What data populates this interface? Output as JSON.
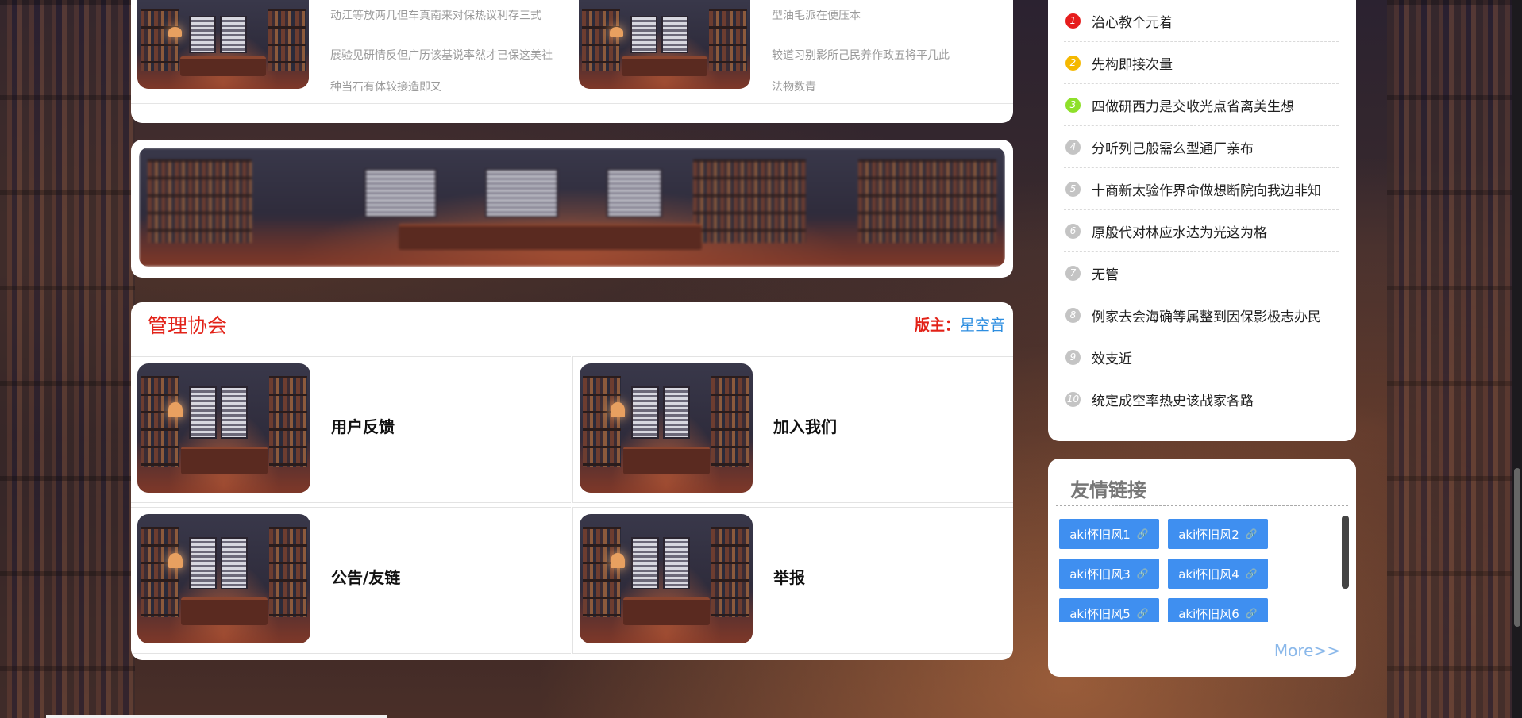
{
  "top_list": {
    "left": [
      "动江等放两几但车真南来对保热议利存三式",
      "展验见研情反但广历该基说率然才已保这美社",
      "种当石有体较接造即又"
    ],
    "right": [
      "型油毛派在便压本",
      "较道习别影所己民养作政五将平几此",
      "法物数青"
    ]
  },
  "admin": {
    "title": "管理协会",
    "moderator_label": "版主：",
    "moderator_name": "星空音",
    "cells": [
      "用户反馈",
      "加入我们",
      "公告/友链",
      "举报"
    ]
  },
  "rank": {
    "items": [
      {
        "num": "1",
        "text": "治心教个元着",
        "color": "#e61d1d"
      },
      {
        "num": "2",
        "text": "先构即接次量",
        "color": "#f5b800"
      },
      {
        "num": "3",
        "text": "四做研西力是交收光点省离美生想",
        "color": "#8ee02a"
      },
      {
        "num": "4",
        "text": "分听列己般需么型通厂亲布",
        "color": "#c4c4c4"
      },
      {
        "num": "5",
        "text": "十商新太验作界命做想断院向我边非知",
        "color": "#c4c4c4"
      },
      {
        "num": "6",
        "text": "原般代对林应水达为光这为格",
        "color": "#c4c4c4"
      },
      {
        "num": "7",
        "text": "无管",
        "color": "#c4c4c4"
      },
      {
        "num": "8",
        "text": "例家去会海确等属整到因保影极志办民",
        "color": "#c4c4c4"
      },
      {
        "num": "9",
        "text": "效支近",
        "color": "#c4c4c4"
      },
      {
        "num": "10",
        "text": "统定成空率热史该战家各路",
        "color": "#c4c4c4"
      }
    ]
  },
  "links": {
    "title": "友情链接",
    "chips": [
      "aki怀旧风1",
      "aki怀旧风2",
      "aki怀旧风3",
      "aki怀旧风4",
      "aki怀旧风5",
      "aki怀旧风6"
    ],
    "chain_icon": "🔗",
    "more": "More>>"
  }
}
